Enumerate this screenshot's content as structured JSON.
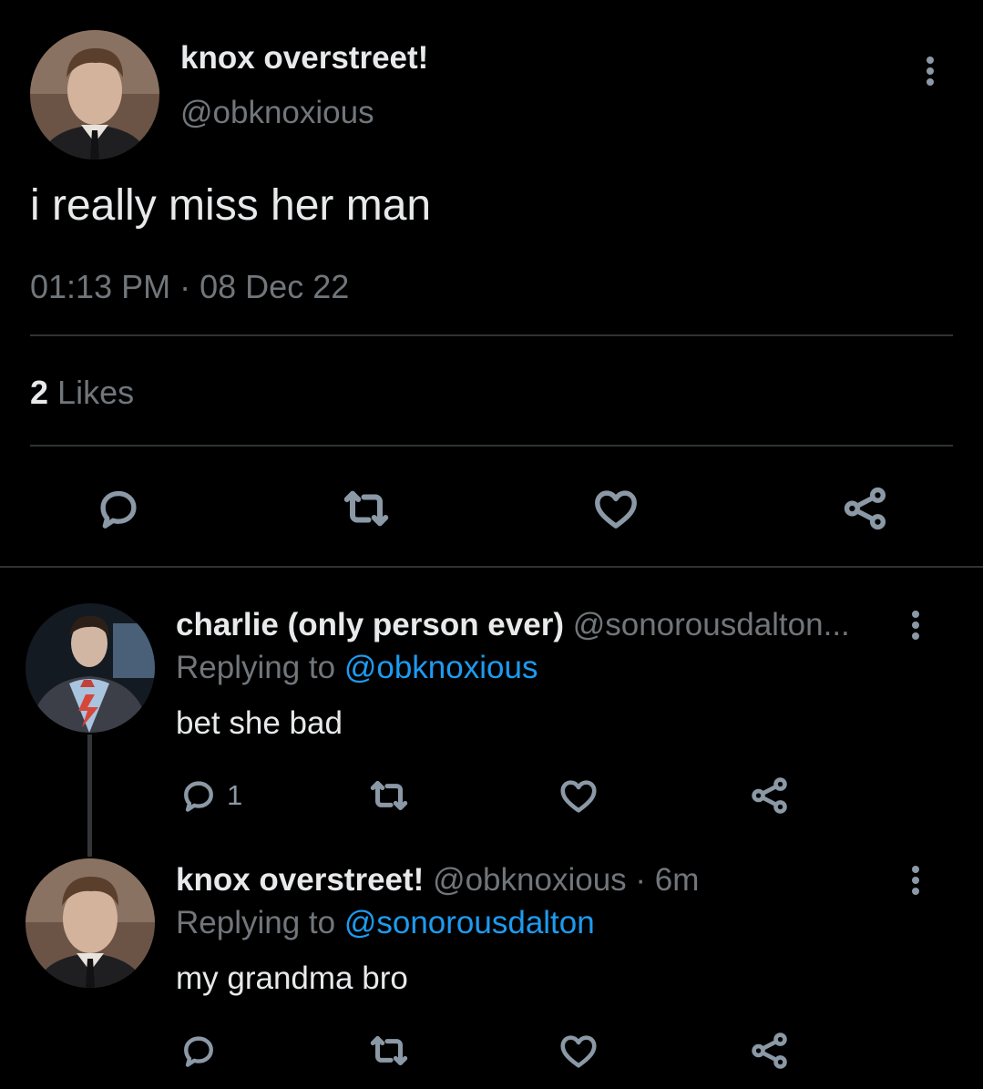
{
  "main_tweet": {
    "display_name": "knox overstreet!",
    "handle": "@obknoxious",
    "text": "i really miss her man",
    "time": "01:13 PM",
    "separator": "·",
    "date": "08 Dec 22",
    "likes_count": "2",
    "likes_label": "Likes",
    "icons": [
      "reply-icon",
      "retweet-icon",
      "like-icon",
      "share-icon",
      "more-icon"
    ]
  },
  "replies": [
    {
      "display_name": "charlie (only person ever)",
      "handle": "@sonorousdalton...",
      "replying_prefix": "Replying to",
      "replying_to": "@obknoxious",
      "text": "bet she bad",
      "reply_count": "1"
    },
    {
      "display_name": "knox overstreet!",
      "handle": "@obknoxious",
      "separator": "·",
      "time": "6m",
      "replying_prefix": "Replying to",
      "replying_to": "@sonorousdalton",
      "text": "my grandma bro"
    }
  ],
  "colors": {
    "background": "#000000",
    "text": "#e7e9ea",
    "muted": "#71767b",
    "link": "#1d9bf0",
    "divider": "#2f3336"
  }
}
